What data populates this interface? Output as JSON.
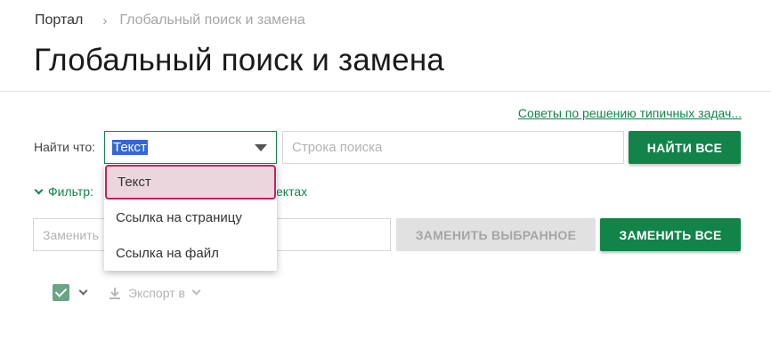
{
  "breadcrumb": {
    "root": "Портал",
    "separator": "›",
    "current": "Глобальный поиск и замена"
  },
  "page_title": "Глобальный поиск и замена",
  "tips_link": "Советы по решению типичных задач...",
  "find": {
    "label": "Найти что:",
    "type_selected": "Текст",
    "search_placeholder": "Строка поиска",
    "find_all_label": "НАЙТИ ВСЕ"
  },
  "filter": {
    "label": "Фильтр:",
    "suffix": "ектах"
  },
  "replace": {
    "placeholder": "Заменить",
    "replace_selected_label": "ЗАМЕНИТЬ ВЫБРАННОЕ",
    "replace_all_label": "ЗАМЕНИТЬ ВСЕ"
  },
  "dropdown": {
    "options": [
      "Текст",
      "Ссылка на страницу",
      "Ссылка на файл"
    ],
    "selected_index": 0
  },
  "toolbar": {
    "export_label": "Экспорт в"
  },
  "colors": {
    "accent": "#12844a",
    "highlight_border": "#c61f5d",
    "highlight_bg": "#ecd6de",
    "text_selection": "#3367d6"
  },
  "icons": [
    "chevron-right-icon",
    "caret-down-icon",
    "chevron-down-icon",
    "checkbox-icon",
    "download-icon"
  ]
}
